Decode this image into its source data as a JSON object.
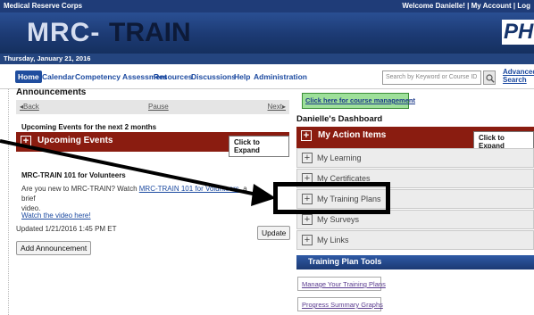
{
  "topbar": {
    "org": "Medical Reserve Corps",
    "welcome": "Welcome Danielle! | My Account | Log"
  },
  "banner": {
    "logo_part1": "MRC-",
    "logo_part2": "TRAIN",
    "partner_logo": "PH"
  },
  "datebar": {
    "date": "Thursday, January 21, 2016"
  },
  "nav": {
    "items": [
      "Home",
      "Calendar",
      "Competency Assessment",
      "Resources",
      "Discussions",
      "Help",
      "Administration"
    ],
    "search_placeholder": "Search by Keyword or Course ID",
    "advanced_search": "Advanced Search"
  },
  "announcements": {
    "title": "Announcements",
    "back": "Back",
    "pause": "Pause",
    "next": "Next",
    "upcoming_title": "Upcoming Events for the next 2 months",
    "upcoming_bar": "Upcoming Events",
    "expand_label": "Click to Expand",
    "mrc101_title": "MRC-TRAIN 101 for Volunteers",
    "mrc101_text_before": "Are you new to MRC-TRAIN? Watch ",
    "mrc101_link": "MRC-TRAIN 101 for Volunteers",
    "mrc101_text_after": ", a brief",
    "mrc101_text_end": "video.",
    "watch_link": "Watch the video here!",
    "updated": "Updated 1/21/2016 1:45 PM ET",
    "update_button": "Update",
    "add_button": "Add Announcement"
  },
  "dashboard": {
    "course_mgmt": "Click here for course management",
    "title": "Danielle's Dashboard",
    "action_items": "My Action Items",
    "expand_label": "Click to Expand",
    "sections": [
      "My Learning",
      "My Certificates",
      "My Training Plans",
      "My Surveys",
      "My Links"
    ],
    "tools_header": "Training Plan Tools",
    "tools": [
      "Manage Your Training Plans",
      "Progress Summary Graphs"
    ]
  },
  "colors": {
    "header_blue": "#1f3c78",
    "red_bar": "#8a1c10",
    "green_button": "#9ee09a",
    "link": "#1c4aa0"
  },
  "icons": {
    "expand": "plus-icon",
    "search": "magnifier-icon",
    "annotation": "arrow-icon"
  }
}
